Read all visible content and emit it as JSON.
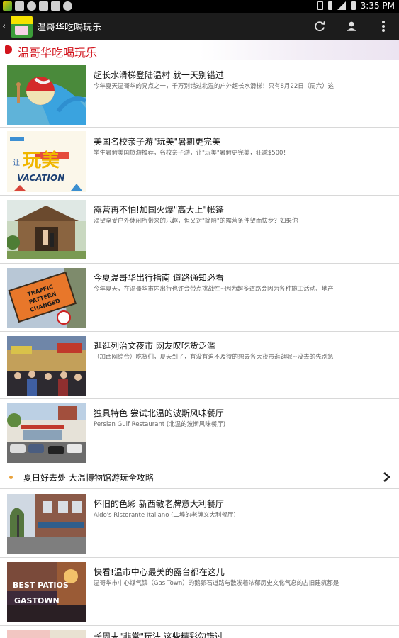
{
  "status_bar": {
    "time": "3:35 PM"
  },
  "app": {
    "title": "温哥华吃喝玩乐",
    "back_glyph": "‹"
  },
  "action_icons": [
    "refresh-icon",
    "user-icon",
    "overflow-menu-icon"
  ],
  "section": {
    "title": "温哥华吃喝玩乐",
    "accent": "#d2141d"
  },
  "articles": [
    {
      "title": "超长水滑梯登陆温村 就一天别错过",
      "subtitle": "今年夏天温哥华的亮点之一，千万别错过北温的户外超长水滑梯！只有8月22日（周六）这"
    },
    {
      "title": "美国名校亲子游\"玩美\"暑期更完美",
      "subtitle": "学生暑假美国旅游推荐，名校亲子游，让\"玩美\"暑假更完美，狂减$500！"
    },
    {
      "title": "露营再不怕!加国火爆\"高大上\"帐篷",
      "subtitle": "渴望享受户外休闲所带来的乐趣，但又对\"简陋\"的露营条件望而怯步？如果你"
    },
    {
      "title": "今夏温哥华出行指南 道路通知必看",
      "subtitle": "今年夏天，在温哥华市内出行也许会带点挑战性~因为超多道路会因为各种施工活动、地产"
    },
    {
      "title": "逛逛列治文夜市 网友叹吃货泛滥",
      "subtitle": "（加西网综合）吃货们，夏天到了，有没有迫不及待的想去各大夜市逛逛呢~没去的先别急"
    },
    {
      "title": "独具特色 尝试北温的波斯风味餐厅",
      "subtitle": "Persian Gulf Restaurant (北温的波斯风味餐厅)"
    },
    {
      "title": "怀旧的色彩 新西敏老牌意大利餐厅",
      "subtitle": "Aldo's Ristorante Italiano (二埠的老牌义大利餐厅)"
    },
    {
      "title": "快看!温市中心最美的露台都在这儿",
      "subtitle": "温哥华市中心煤气镇（Gas Town）的鹅卵石道路与散发着浓郁历史文化气息的古旧建筑都是"
    },
    {
      "title": "长周末\"非常\"玩法 这些精彩勿错过",
      "subtitle": ""
    }
  ],
  "text_item": {
    "title": "夏日好去处 大温博物馆游玩全攻略"
  },
  "thumb_text": {
    "vacation_play": "玩美",
    "vacation_word": "VACATION",
    "traffic_sign": "TRAFFIC PATTERN CHANGED",
    "patios_1": "BEST PATIOS",
    "patios_2": "GASTOWN"
  }
}
